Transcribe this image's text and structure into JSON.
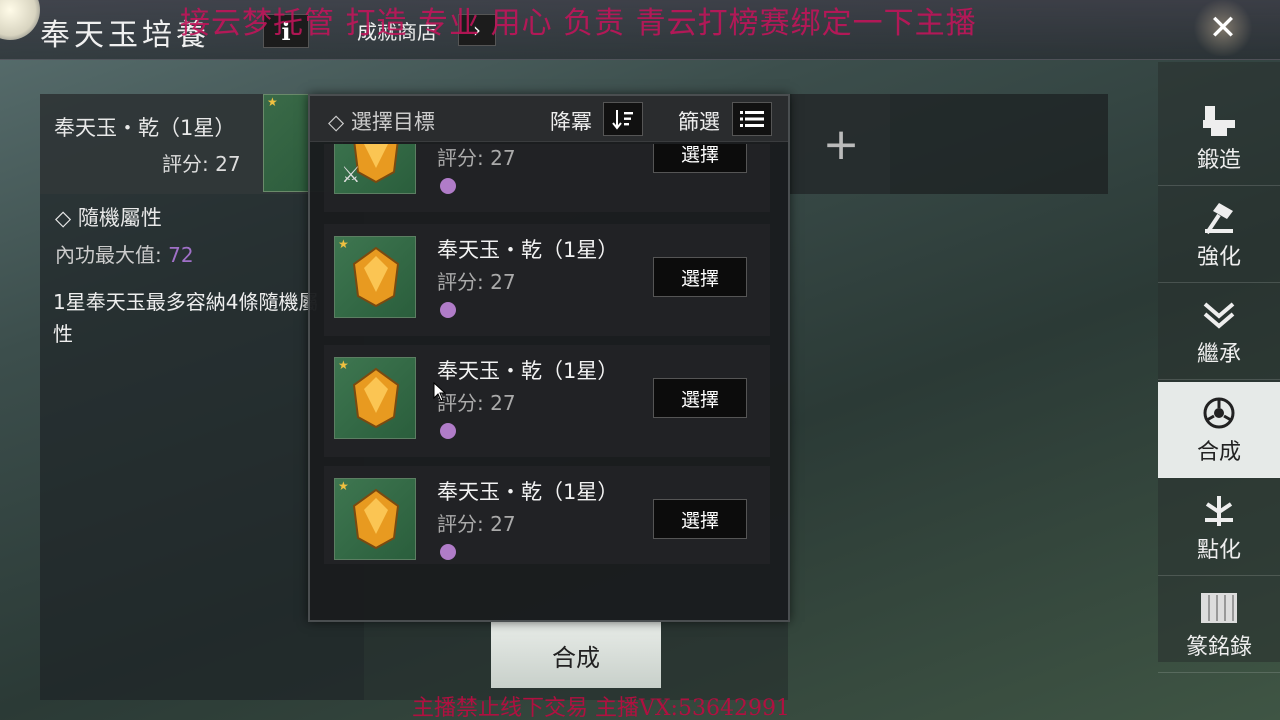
{
  "header": {
    "title": "奉天玉培養",
    "info_label": "i",
    "shop_label": "成就商店",
    "shop_arrow": "›",
    "close_label": "✕"
  },
  "overlay": {
    "top_text": "接云梦托管 打造 专业 用心 负责   青云打榜赛绑定一下主播",
    "bottom_text": "主播禁止线下交易    主播VX:53642991"
  },
  "left": {
    "item_name": "奉天玉・乾（1星）",
    "score": "評分: 27",
    "attr_title": "◇ 隨機屬性",
    "attr_label": "內功最大值:",
    "attr_value": "72",
    "description": "1星奉天玉最多容納4條隨機屬性"
  },
  "popup": {
    "title": "◇ 選擇目標",
    "sort_label": "降冪",
    "filter_label": "篩選",
    "items": [
      {
        "name": "",
        "score": "評分: 27",
        "button": "選擇"
      },
      {
        "name": "奉天玉・乾（1星）",
        "score": "評分: 27",
        "button": "選擇"
      },
      {
        "name": "奉天玉・乾（1星）",
        "score": "評分: 27",
        "button": "選擇"
      },
      {
        "name": "奉天玉・乾（1星）",
        "score": "評分: 27",
        "button": "選擇"
      }
    ]
  },
  "actions": {
    "add_label": "+",
    "synthesize_label": "合成"
  },
  "nav": {
    "items": [
      {
        "label": "鍛造",
        "icon": "anvil-icon"
      },
      {
        "label": "強化",
        "icon": "hammer-icon"
      },
      {
        "label": "繼承",
        "icon": "inherit-icon"
      },
      {
        "label": "合成",
        "icon": "synthesis-icon",
        "active": true
      },
      {
        "label": "點化",
        "icon": "enlighten-icon"
      },
      {
        "label": "篆銘錄",
        "icon": "scroll-icon"
      }
    ]
  },
  "colors": {
    "accent_purple": "#a070c8",
    "overlay_red": "#c0155a",
    "star_gold": "#f0c040"
  }
}
